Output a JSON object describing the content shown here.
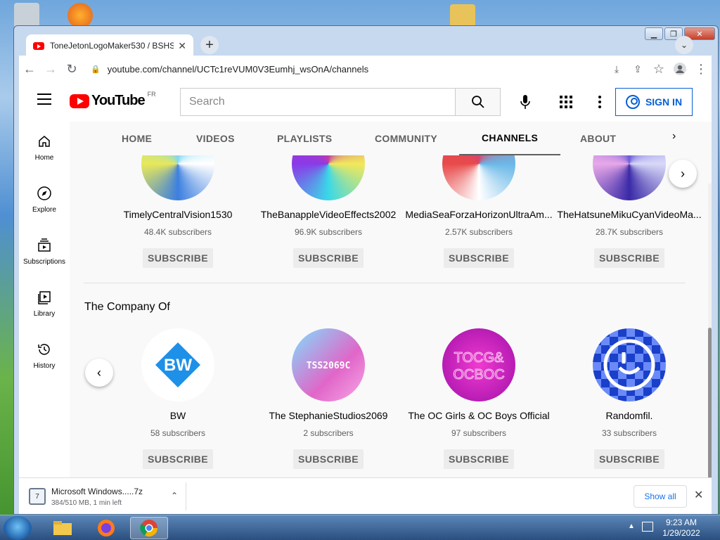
{
  "browser": {
    "tab_title": "ToneJetonLogoMaker530 / BSHS",
    "url": "youtube.com/channel/UCTc1reVUM0V3Eumhj_wsOnA/channels",
    "newtab_label": "+",
    "close_glyph": "✕"
  },
  "youtube": {
    "logo_text": "YouTube",
    "region": "FR",
    "search_placeholder": "Search",
    "sign_in": "SIGN IN"
  },
  "sidebar": {
    "items": [
      {
        "label": "Home",
        "icon": "home-icon"
      },
      {
        "label": "Explore",
        "icon": "compass-icon"
      },
      {
        "label": "Subscriptions",
        "icon": "subscriptions-icon"
      },
      {
        "label": "Library",
        "icon": "library-icon"
      },
      {
        "label": "History",
        "icon": "history-icon"
      }
    ]
  },
  "channel_tabs": [
    "HOME",
    "VIDEOS",
    "PLAYLISTS",
    "COMMUNITY",
    "CHANNELS",
    "ABOUT"
  ],
  "active_tab": "CHANNELS",
  "shelf1": {
    "channels": [
      {
        "name": "TimelyCentralVision1530",
        "subs": "48.4K subscribers",
        "btn": "SUBSCRIBE",
        "color": "#7fd8f2"
      },
      {
        "name": "TheBanappleVideoEffects2002",
        "subs": "96.9K subscribers",
        "btn": "SUBSCRIBE",
        "color": "#c23aa8"
      },
      {
        "name": "MediaSeaForzaHorizonUltraAm...",
        "subs": "2.57K subscribers",
        "btn": "SUBSCRIBE",
        "color": "#d8446a"
      },
      {
        "name": "TheHatsuneMikuCyanVideoMa...",
        "subs": "28.7K subscribers",
        "btn": "SUBSCRIBE",
        "color": "#6a5ad8"
      }
    ]
  },
  "shelf2": {
    "title": "The Company Of",
    "channels": [
      {
        "name": "BW",
        "subs": "58 subscribers",
        "btn": "SUBSCRIBE",
        "avatar_text": "BW",
        "color": "#1e90e8"
      },
      {
        "name": "The StephanieStudios2069",
        "subs": "2 subscribers",
        "btn": "SUBSCRIBE",
        "avatar_text": "TSS2069C",
        "color": "#e066c8"
      },
      {
        "name": "The OC Girls & OC Boys Official",
        "subs": "97 subscribers",
        "btn": "SUBSCRIBE",
        "avatar_text": "TOCG& OCBOC",
        "color": "#d81ec0"
      },
      {
        "name": "Randomfil.",
        "subs": "33 subscribers",
        "btn": "SUBSCRIBE",
        "avatar_text": "",
        "color": "#1a3fc8"
      }
    ]
  },
  "download": {
    "name": "Microsoft Windows.....7z",
    "status": "384/510 MB, 1 min left",
    "show_all": "Show all"
  },
  "taskbar": {
    "time": "9:23 AM",
    "date": "1/29/2022"
  }
}
